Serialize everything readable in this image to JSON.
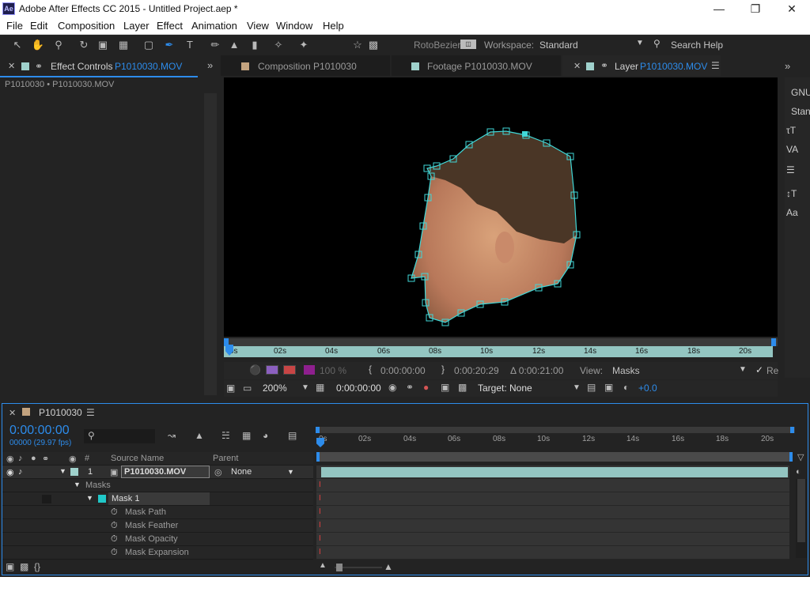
{
  "window": {
    "title": "Adobe After Effects CC 2015 - Untitled Project.aep *",
    "logo": "Ae"
  },
  "menu": [
    "File",
    "Edit",
    "Composition",
    "Layer",
    "Effect",
    "Animation",
    "View",
    "Window",
    "Help"
  ],
  "toolbar": {
    "rotobezier": "RotoBezier",
    "workspace_label": "Workspace:",
    "workspace_value": "Standard",
    "search_placeholder": "Search Help"
  },
  "effect_controls": {
    "tab_label": "Effect Controls",
    "tab_file": "P1010030.MOV",
    "breadcrumb": "P1010030 • P1010030.MOV"
  },
  "viewer_tabs": {
    "composition_label": "Composition P1010030",
    "footage_label": "Footage P1010030.MOV",
    "layer_label": "Layer",
    "layer_file": "P1010030.MOV"
  },
  "right_panel": {
    "line1": "GNU",
    "line2": "Stan"
  },
  "layer_ruler": [
    "0s",
    "02s",
    "04s",
    "06s",
    "08s",
    "10s",
    "12s",
    "14s",
    "16s",
    "18s",
    "20s"
  ],
  "layer_controls": {
    "zoom_pct": "100 %",
    "in_time": "0:00:00:00",
    "out_time": "0:00:20:29",
    "duration": "Δ 0:00:21:00",
    "view_label": "View:",
    "view_value": "Masks",
    "render_label": "Re",
    "zoom": "200%",
    "current_time": "0:00:00:00",
    "target": "Target: None",
    "exposure": "+0.0"
  },
  "timeline": {
    "comp_name": "P1010030",
    "timecode": "0:00:00:00",
    "frame_info": "00000 (29.97 fps)",
    "search_placeholder": "",
    "col_hash": "#",
    "col_source": "Source Name",
    "col_parent": "Parent",
    "ruler": [
      "0s",
      "02s",
      "04s",
      "06s",
      "08s",
      "10s",
      "12s",
      "14s",
      "16s",
      "18s",
      "20s"
    ],
    "layer": {
      "index": "1",
      "name": "P1010030.MOV",
      "parent": "None"
    },
    "masks_group": "Masks",
    "mask_name": "Mask 1",
    "props": [
      "Mask Path",
      "Mask Feather",
      "Mask Opacity",
      "Mask Expansion"
    ]
  },
  "colors": {
    "accent": "#2d8ceb",
    "mask": "#40d8d8",
    "bar": "#93c5c1",
    "label_cyan": "#20c8c8"
  }
}
